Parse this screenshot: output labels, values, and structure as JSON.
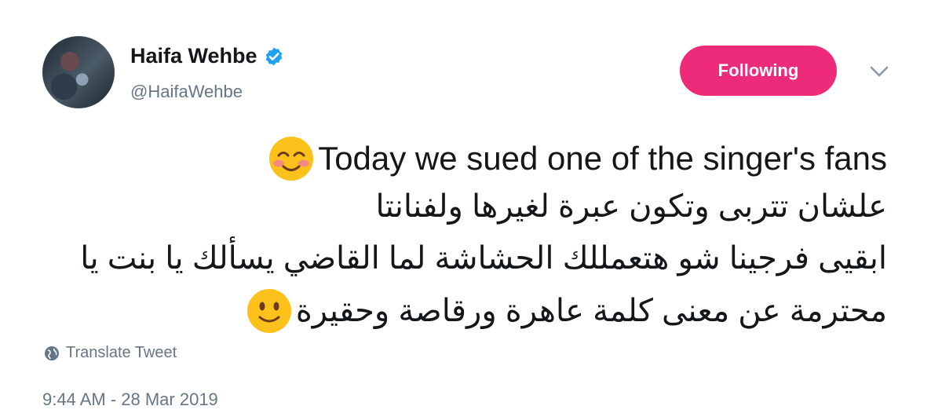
{
  "user": {
    "name": "Haifa Wehbe",
    "handle": "@HaifaWehbe",
    "verified": true
  },
  "follow_button": {
    "label": "Following",
    "color": "#ee2b7b"
  },
  "tweet": {
    "line1": "Today we sued one of the singer's fans",
    "line2": "علشان تتربى وتكون عبرة لغيرها ولفنانتا",
    "line3": "ابقيى فرجينا شو هتعمللك الحشاشة لما القاضي يسألك يا بنت يا",
    "line4": "محترمة عن معنى كلمة عاهرة ورقاصة وحقيرة",
    "emoji1": "smiling-face-with-blush",
    "emoji2": "slightly-smiling-face"
  },
  "translate_label": "Translate Tweet",
  "timestamp": "9:44 AM - 28 Mar 2019",
  "colors": {
    "link_gray": "#657786",
    "verified_blue": "#1da1f2",
    "text": "#14171a"
  }
}
